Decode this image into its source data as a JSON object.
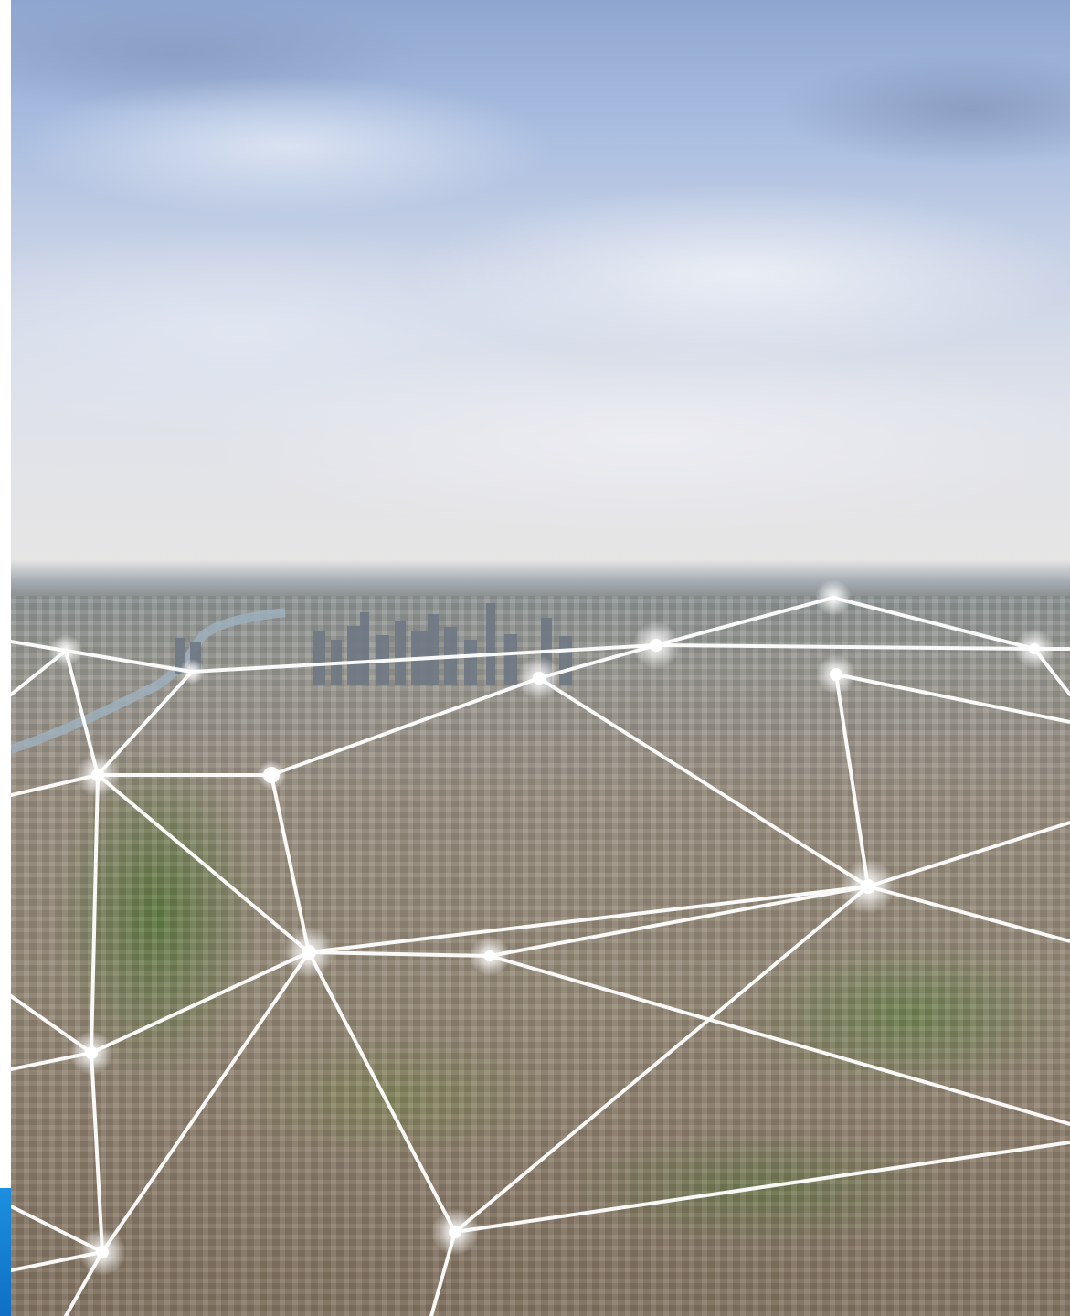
{
  "image": {
    "subject": "aerial-city-network",
    "colors": {
      "sky_top": "#8ea6cf",
      "sky_bottom": "#e8e6e4",
      "city_tone": "#968a78",
      "network_line": "#ffffff",
      "accent_strip": "#1d8fe0"
    }
  }
}
